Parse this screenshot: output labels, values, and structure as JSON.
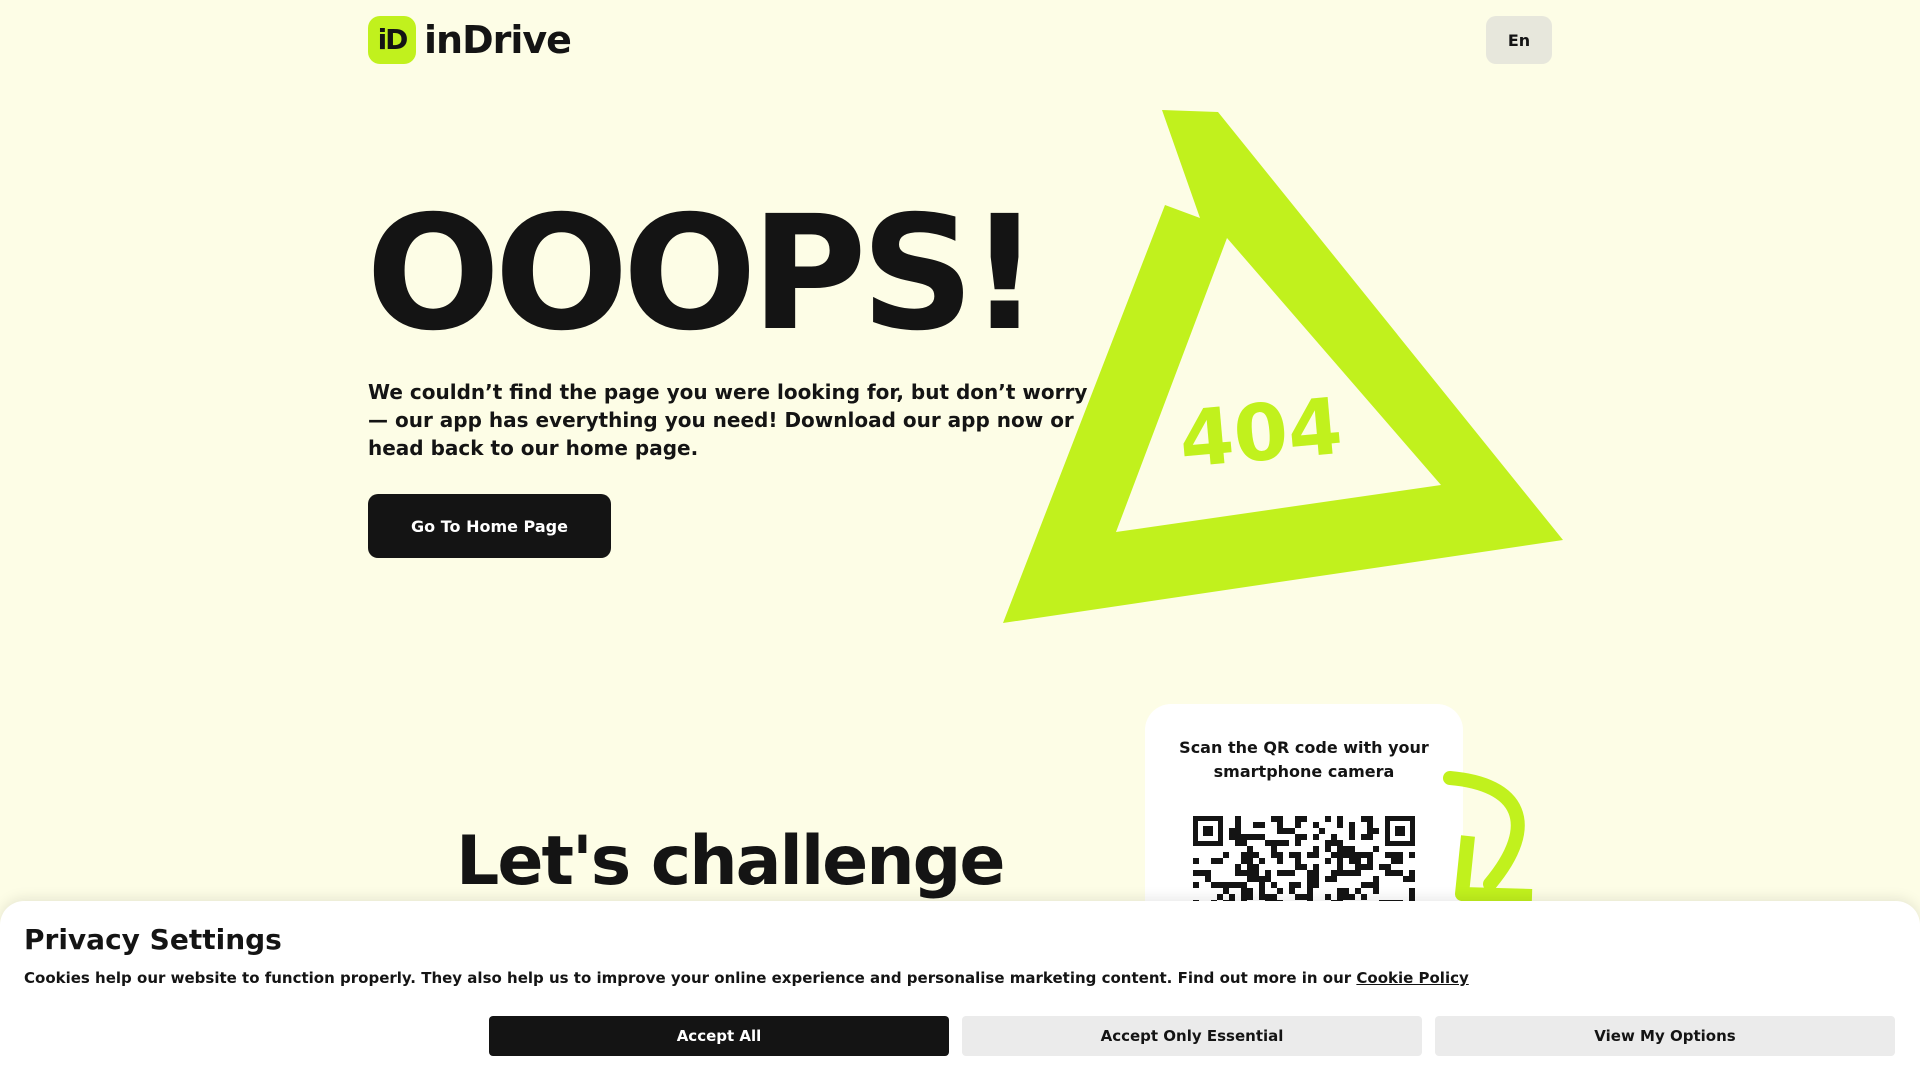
{
  "header": {
    "logo_mark": "iD",
    "logo_text": "inDrive",
    "language_label": "En"
  },
  "hero": {
    "title": "OOOPS!",
    "description": "We couldn’t find the page you were looking for, but don’t worry — our app has everything you need! Download our app now or head back to our home page.",
    "home_button_label": "Go To Home Page",
    "badge_text": "404"
  },
  "promo": {
    "heading": "Let's challenge",
    "qr_caption": "Scan the QR code with your smartphone camera"
  },
  "privacy": {
    "title": "Privacy Settings",
    "text": "Cookies help our website to function properly. They also help us to improve your online experience and personalise marketing content. Find out more in our ",
    "link_label": "Cookie Policy",
    "buttons": {
      "accept_all": "Accept All",
      "accept_essential": "Accept Only Essential",
      "view_options": "View My Options"
    }
  },
  "colors": {
    "background": "#FDFDE6",
    "accent": "#C1F11D",
    "dark": "#141414",
    "button_light": "#EBEBEB"
  },
  "icons": {
    "logo": "indrive-logo-icon",
    "triangle": "triangle-graphic",
    "arrow": "curved-arrow-icon",
    "qr": "qr-code-icon"
  }
}
